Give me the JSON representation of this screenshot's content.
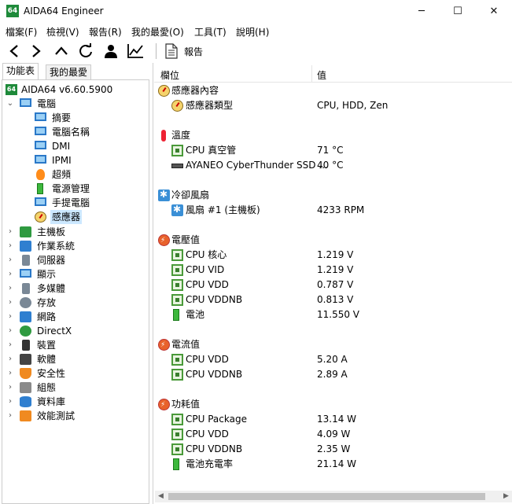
{
  "window": {
    "title": "AIDA64 Engineer",
    "app_icon_text": "64",
    "minimize": "─",
    "maximize": "☐",
    "close": "✕"
  },
  "menu": [
    "檔案(F)",
    "檢視(V)",
    "報告(R)",
    "我的最愛(O)",
    "工具(T)",
    "說明(H)"
  ],
  "toolbar": {
    "report_label": "報告"
  },
  "left_tabs": [
    "功能表",
    "我的最愛"
  ],
  "tree": {
    "root": "AIDA64 v6.60.5900",
    "computer": "電腦",
    "computer_children": [
      "摘要",
      "電腦名稱",
      "DMI",
      "IPMI",
      "超頻",
      "電源管理",
      "手提電腦",
      "感應器"
    ],
    "top_items": [
      "主機板",
      "作業系統",
      "伺服器",
      "顯示",
      "多媒體",
      "存放",
      "網路",
      "DirectX",
      "裝置",
      "軟體",
      "安全性",
      "組態",
      "資料庫",
      "效能測試"
    ]
  },
  "columns": {
    "field": "欄位",
    "value": "值"
  },
  "sections": [
    {
      "title": "感應器內容",
      "icon": "gauge",
      "items": [
        {
          "label": "感應器類型",
          "value": "CPU, HDD, Zen",
          "icon": "gauge"
        }
      ]
    },
    {
      "title": "溫度",
      "icon": "therm",
      "items": [
        {
          "label": "CPU 真空管",
          "value": "71 °C",
          "icon": "chip"
        },
        {
          "label": "AYANEO CyberThunder SSD ...",
          "value": "40 °C",
          "icon": "disk"
        }
      ]
    },
    {
      "title": "冷卻風扇",
      "icon": "fan",
      "items": [
        {
          "label": "風扇 #1 (主機板)",
          "value": "4233 RPM",
          "icon": "fan"
        }
      ]
    },
    {
      "title": "電壓值",
      "icon": "warn",
      "items": [
        {
          "label": "CPU 核心",
          "value": "1.219 V",
          "icon": "chip"
        },
        {
          "label": "CPU VID",
          "value": "1.219 V",
          "icon": "chip"
        },
        {
          "label": "CPU VDD",
          "value": "0.787 V",
          "icon": "chip"
        },
        {
          "label": "CPU VDDNB",
          "value": "0.813 V",
          "icon": "chip"
        },
        {
          "label": "電池",
          "value": "11.550 V",
          "icon": "bat"
        }
      ]
    },
    {
      "title": "電流值",
      "icon": "warn",
      "items": [
        {
          "label": "CPU VDD",
          "value": "5.20 A",
          "icon": "chip"
        },
        {
          "label": "CPU VDDNB",
          "value": "2.89 A",
          "icon": "chip"
        }
      ]
    },
    {
      "title": "功耗值",
      "icon": "warn",
      "items": [
        {
          "label": "CPU Package",
          "value": "13.14 W",
          "icon": "chip"
        },
        {
          "label": "CPU VDD",
          "value": "4.09 W",
          "icon": "chip"
        },
        {
          "label": "CPU VDDNB",
          "value": "2.35 W",
          "icon": "chip"
        },
        {
          "label": "電池充電率",
          "value": "21.14 W",
          "icon": "bat"
        }
      ]
    }
  ]
}
